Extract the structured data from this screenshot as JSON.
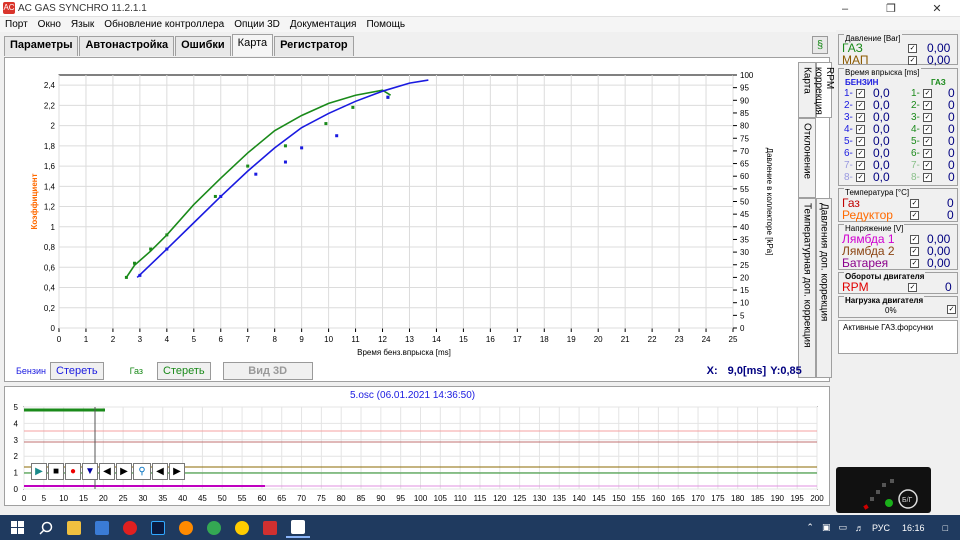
{
  "window": {
    "title": "AC GAS SYNCHRO  11.2.1.1",
    "app_icon": "AC"
  },
  "menu": [
    "Порт",
    "Окно",
    "Язык",
    "Обновление контроллера",
    "Опции 3D",
    "Документация",
    "Помощь"
  ],
  "tabs": [
    "Параметры",
    "Автонастройка",
    "Ошибки",
    "Карта",
    "Регистратор"
  ],
  "side_tabs": [
    "Карта",
    "RPM коррекция",
    "Отклонение",
    "Давления доп. коррекция",
    "Температурная доп. коррекция"
  ],
  "chart_data": {
    "type": "scatter",
    "xlabel": "Время бенз.впрыска [ms]",
    "ylabel_left": "Коэффициент",
    "ylabel_right": "Давление в коллекторе [kPa]",
    "x_ticks": [
      "0",
      "1",
      "2",
      "3",
      "4",
      "5",
      "6",
      "7",
      "8",
      "9",
      "10",
      "11",
      "12",
      "13",
      "14",
      "15",
      "16",
      "17",
      "18",
      "19",
      "20",
      "21",
      "22",
      "23",
      "24",
      "25"
    ],
    "y_ticks_left": [
      "0",
      "0,2",
      "0,4",
      "0,6",
      "0,8",
      "1",
      "1,2",
      "1,4",
      "1,6",
      "1,8",
      "2",
      "2,2",
      "2,4"
    ],
    "y_ticks_right": [
      "0",
      "5",
      "10",
      "15",
      "20",
      "25",
      "30",
      "35",
      "40",
      "45",
      "50",
      "55",
      "60",
      "65",
      "70",
      "75",
      "80",
      "85",
      "90",
      "95",
      "100"
    ],
    "xlim": [
      0,
      25
    ],
    "ylim": [
      0,
      2.5
    ],
    "series": [
      {
        "color": "#1a8a1a",
        "x": [
          2.5,
          2.8,
          3.4,
          4.0,
          5.0,
          6.0,
          7.0,
          8.0,
          9.0,
          10.0,
          11.0,
          12.0,
          12.3
        ],
        "y": [
          0.5,
          0.62,
          0.76,
          0.92,
          1.22,
          1.48,
          1.73,
          1.95,
          2.1,
          2.22,
          2.3,
          2.35,
          2.3
        ]
      },
      {
        "color": "#1a1ae0",
        "x": [
          2.9,
          4.0,
          5.0,
          6.0,
          7.0,
          8.0,
          9.0,
          10.0,
          11.0,
          12.0,
          13.0,
          13.7
        ],
        "y": [
          0.5,
          0.78,
          1.04,
          1.3,
          1.55,
          1.78,
          1.98,
          2.12,
          2.24,
          2.34,
          2.42,
          2.45
        ]
      }
    ],
    "dots_green": [
      [
        2.5,
        0.5
      ],
      [
        2.8,
        0.64
      ],
      [
        3.4,
        0.78
      ],
      [
        4.0,
        0.92
      ],
      [
        5.8,
        1.3
      ],
      [
        7.0,
        1.6
      ],
      [
        8.4,
        1.8
      ],
      [
        9.9,
        2.02
      ],
      [
        10.9,
        2.18
      ],
      [
        12.2,
        2.28
      ]
    ],
    "dots_blue": [
      [
        3.0,
        0.52
      ],
      [
        4.0,
        0.78
      ],
      [
        6.0,
        1.3
      ],
      [
        7.3,
        1.52
      ],
      [
        8.4,
        1.64
      ],
      [
        9.0,
        1.78
      ],
      [
        10.3,
        1.9
      ],
      [
        12.2,
        2.28
      ]
    ]
  },
  "legend_bar": {
    "benzin_label": "Бензин",
    "benzin_clear": "Стереть",
    "gas_label": "Газ",
    "gas_clear": "Стереть",
    "view3d": "Вид 3D",
    "x_label": "X:",
    "x_value": "9,0[ms]",
    "y_label": "Y:0,85"
  },
  "osc": {
    "title": "5.osc  (06.01.2021 14:36:50)",
    "y_ticks": [
      "5",
      "4",
      "3",
      "2",
      "1",
      "0"
    ],
    "x_ticks": [
      "0",
      "5",
      "10",
      "15",
      "20",
      "25",
      "30",
      "35",
      "40",
      "45",
      "50",
      "55",
      "60",
      "65",
      "70",
      "75",
      "80",
      "85",
      "90",
      "95",
      "100",
      "105",
      "110",
      "115",
      "120",
      "125",
      "130",
      "135",
      "140",
      "145",
      "150",
      "155",
      "160",
      "165",
      "170",
      "175",
      "180",
      "185",
      "190",
      "195",
      "200"
    ]
  },
  "right": {
    "pressure_title": "Давление [Bar]",
    "gas_label": "ГАЗ",
    "gas_val": "0,00",
    "map_label": "МАП",
    "map_val": "0,00",
    "inj_title": "Время впрыска [ms]",
    "benzin_head": "БЕНЗИН",
    "gas_head": "ГАЗ",
    "inj_rows": [
      {
        "n": "1-",
        "b": "0,0",
        "gn": "1-",
        "g": "0"
      },
      {
        "n": "2-",
        "b": "0,0",
        "gn": "2-",
        "g": "0"
      },
      {
        "n": "3-",
        "b": "0,0",
        "gn": "3-",
        "g": "0"
      },
      {
        "n": "4-",
        "b": "0,0",
        "gn": "4-",
        "g": "0"
      },
      {
        "n": "5-",
        "b": "0,0",
        "gn": "5-",
        "g": "0"
      },
      {
        "n": "6-",
        "b": "0,0",
        "gn": "6-",
        "g": "0"
      },
      {
        "n": "7-",
        "b": "0,0",
        "gn": "7-",
        "g": "0"
      },
      {
        "n": "8-",
        "b": "0,0",
        "gn": "8-",
        "g": "0"
      }
    ],
    "temp_title": "Температура  [°C]",
    "temp_gas": "Газ",
    "temp_gas_val": "0",
    "temp_red": "Редуктор",
    "temp_red_val": "0",
    "volt_title": "Напряжение [V]",
    "lambda1": "Лямбда 1",
    "lambda1_val": "0,00",
    "lambda2": "Лямбда 2",
    "lambda2_val": "0,00",
    "battery": "Батарея",
    "battery_val": "0,00",
    "rpm_title": "Обороты двигателя",
    "rpm_label": "RPM",
    "rpm_val": "0",
    "load_title": "Нагрузка двигателя",
    "load_val": "0%",
    "active_inj": "Активные ГАЗ.форсунки"
  },
  "taskbar": {
    "lang": "РУС",
    "time": "16:16"
  }
}
